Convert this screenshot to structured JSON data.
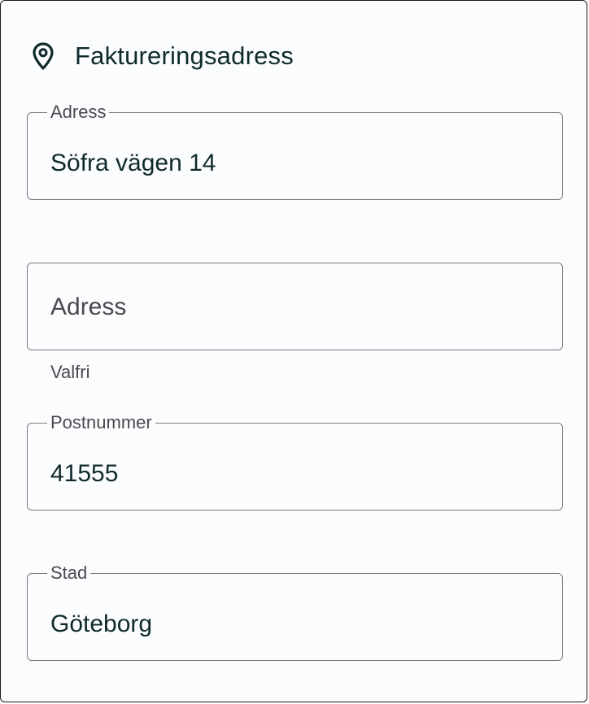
{
  "section": {
    "title": "Faktureringsadress",
    "icon": "location-pin-icon"
  },
  "fields": {
    "address_line1": {
      "label": "Adress",
      "value": "Söfra vägen 14"
    },
    "address_line2": {
      "placeholder": "Adress",
      "helper": "Valfri"
    },
    "postal_code": {
      "label": "Postnummer",
      "value": "41555"
    },
    "city": {
      "label": "Stad",
      "value": "Göteborg"
    }
  },
  "colors": {
    "text": "#102a2c",
    "label": "#4a4a4e",
    "border": "#7a7a7e",
    "background": "#fbfcfe"
  }
}
